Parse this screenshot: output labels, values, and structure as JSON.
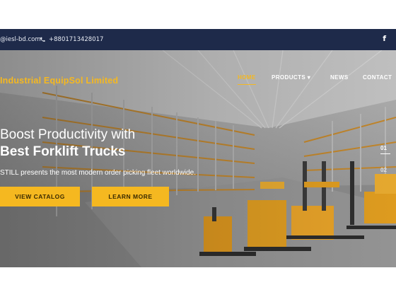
{
  "topbar": {
    "email": "@iesl-bd.com",
    "phone": "+8801713428017",
    "social_icon": "facebook-icon",
    "social_glyph": "f"
  },
  "brand": {
    "name": "Industrial EquipSol Limited"
  },
  "nav": {
    "items": [
      {
        "label": "HOME",
        "active": true
      },
      {
        "label": "PRODUCTS ▾",
        "active": false
      },
      {
        "label": "NEWS",
        "active": false
      },
      {
        "label": "CONTACT",
        "active": false
      }
    ]
  },
  "hero": {
    "headline_line1": "Boost Productivity with",
    "headline_line2": "Best Forklift Trucks",
    "subline": "STILL presents the most modern order picking fleet worldwide.",
    "btn_catalog": "VIEW CATALOG",
    "btn_learn": "LEARN MORE",
    "slide_current": "01",
    "slide_next": "02"
  },
  "colors": {
    "topbar_bg": "#1e2a4a",
    "accent": "#f5b820"
  }
}
